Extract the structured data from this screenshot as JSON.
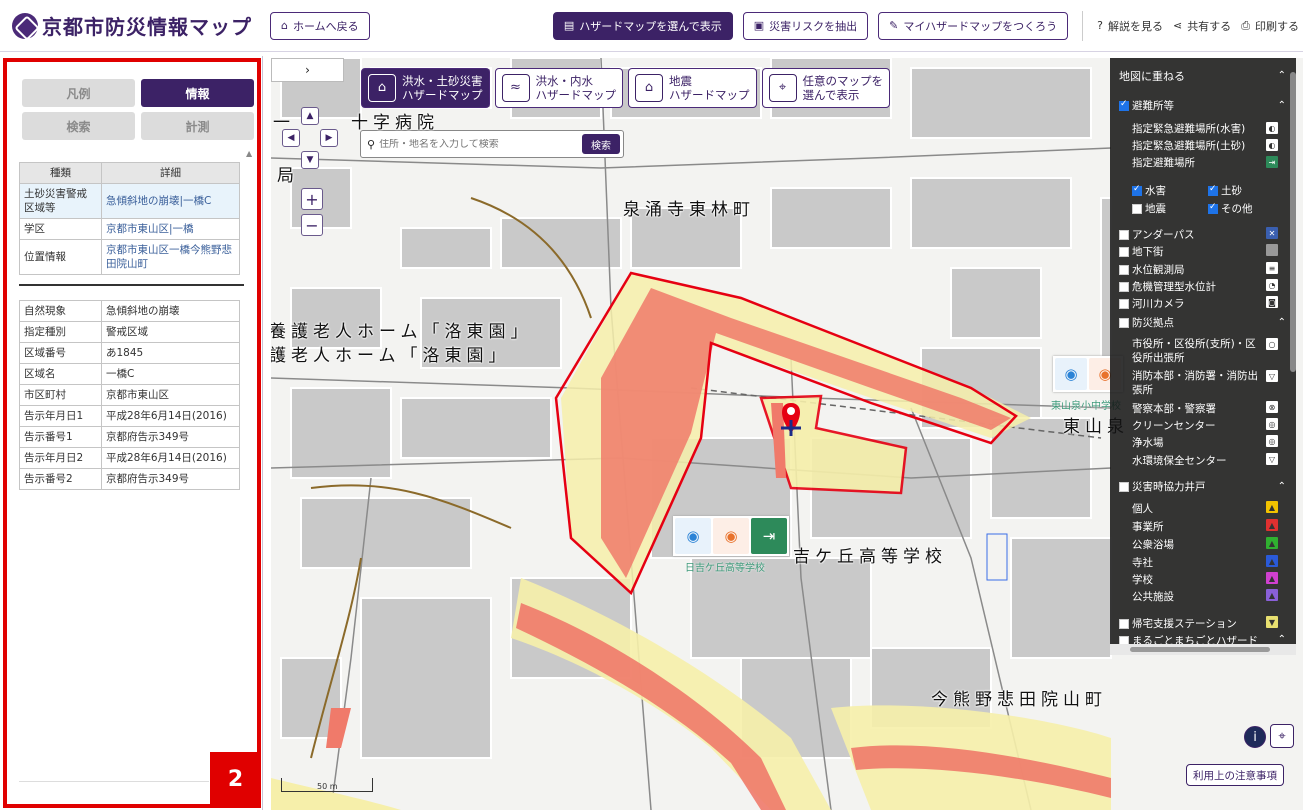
{
  "header": {
    "app_title": "京都市防災情報マップ",
    "home_label": "ホームへ戻る",
    "select_map_label": "ハザードマップを選んで表示",
    "extract_risk_label": "災害リスクを抽出",
    "my_map_label": "マイハザードマップをつくろう",
    "help_label": "解説を見る",
    "share_label": "共有する",
    "print_label": "印刷する"
  },
  "left_panel": {
    "tabs": [
      "凡例",
      "情報",
      "検索",
      "計測"
    ],
    "active_tab": "情報",
    "table1": {
      "headers": [
        "種類",
        "詳細"
      ],
      "rows": [
        {
          "key": "土砂災害警戒区域等",
          "value": "急傾斜地の崩壊|一橋C"
        },
        {
          "key": "学区",
          "value": "京都市東山区|一橋"
        },
        {
          "key": "位置情報",
          "value": "京都市東山区一橋今熊野悲田院山町"
        }
      ]
    },
    "table2": {
      "rows": [
        {
          "key": "自然現象",
          "value": "急傾斜地の崩壊"
        },
        {
          "key": "指定種別",
          "value": "警戒区域"
        },
        {
          "key": "区域番号",
          "value": "あ1845"
        },
        {
          "key": "区域名",
          "value": "一橋C"
        },
        {
          "key": "市区町村",
          "value": "京都市東山区"
        },
        {
          "key": "告示年月日1",
          "value": "平成28年6月14日(2016)"
        },
        {
          "key": "告示番号1",
          "value": "京都府告示349号"
        },
        {
          "key": "告示年月日2",
          "value": "平成28年6月14日(2016)"
        },
        {
          "key": "告示番号2",
          "value": "京都府告示349号"
        }
      ]
    },
    "badge": "2"
  },
  "map": {
    "toggle_label": "›",
    "hazard_tabs": [
      {
        "line1": "洪水・土砂災害",
        "line2": "ハザードマップ",
        "active": true
      },
      {
        "line1": "洪水・内水",
        "line2": "ハザードマップ",
        "active": false
      },
      {
        "line1": "地震",
        "line2": "ハザードマップ",
        "active": false
      },
      {
        "line1": "任意のマップを",
        "line2": "選んで表示",
        "active": false
      }
    ],
    "search_placeholder": "住所・地名を入力して検索",
    "search_button": "検索",
    "zoom_in": "+",
    "zoom_out": "−",
    "labels": {
      "hospital": "十字病院",
      "hospital_prefix": "一",
      "kyoku": "局",
      "area1": "泉涌寺東林町",
      "home1": "養護老人ホーム「洛東園」",
      "home2": "護老人ホーム「洛東園」",
      "school": "吉ケ丘高等学校",
      "area2": "今熊野悲田院山町",
      "higashiyama": "東山泉"
    },
    "poi_labels": {
      "school_poi": "日吉ケ丘高等学校",
      "jhs_poi": "東山泉小中学校"
    },
    "scale": "50 m",
    "notice": "利用上の注意事項",
    "info_icon": "i"
  },
  "layers_panel": {
    "title": "地図に重ねる",
    "shelter_group": "避難所等",
    "shelter_items": [
      "指定緊急避難場所(水害)",
      "指定緊急避難場所(土砂)",
      "指定避難場所"
    ],
    "hazard_checks": [
      {
        "label": "水害",
        "checked": true
      },
      {
        "label": "土砂",
        "checked": true
      },
      {
        "label": "地震",
        "checked": false
      },
      {
        "label": "その他",
        "checked": true
      }
    ],
    "items": [
      "アンダーパス",
      "地下街",
      "水位観測局",
      "危機管理型水位計",
      "河川カメラ"
    ],
    "base_group": "防災拠点",
    "base_items": [
      "市役所・区役所(支所)・区役所出張所",
      "消防本部・消防署・消防出張所",
      "警察本部・警察署",
      "クリーンセンター",
      "浄水場",
      "水環境保全センター"
    ],
    "well_group": "災害時協力井戸",
    "well_items": [
      "個人",
      "事業所",
      "公衆浴場",
      "寺社",
      "学校",
      "公共施設"
    ],
    "station": "帰宅支援ステーション",
    "machi": "まるごとまちごとハザード"
  },
  "colors": {
    "brand": "#3c2266",
    "hazard_red": "#f07a6a",
    "hazard_yellow": "#f6efaa",
    "boundary": "#e60012"
  }
}
